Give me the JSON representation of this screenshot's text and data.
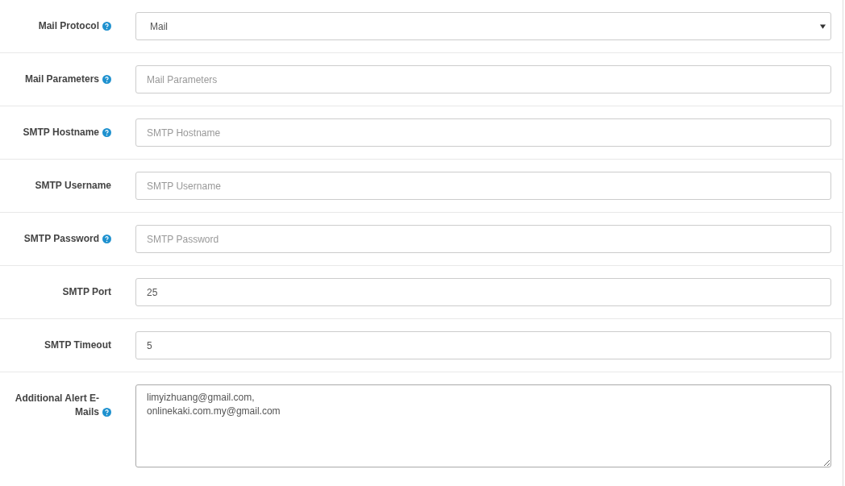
{
  "fields": [
    {
      "kind": "select",
      "label": "Mail Protocol",
      "help": true,
      "value": "Mail"
    },
    {
      "kind": "text",
      "label": "Mail Parameters",
      "help": true,
      "placeholder": "Mail Parameters"
    },
    {
      "kind": "text",
      "label": "SMTP Hostname",
      "help": true,
      "placeholder": "SMTP Hostname"
    },
    {
      "kind": "text",
      "label": "SMTP Username",
      "help": false,
      "placeholder": "SMTP Username"
    },
    {
      "kind": "text",
      "label": "SMTP Password",
      "help": true,
      "placeholder": "SMTP Password"
    },
    {
      "kind": "text",
      "label": "SMTP Port",
      "help": false,
      "value": "25"
    },
    {
      "kind": "text",
      "label": "SMTP Timeout",
      "help": false,
      "value": "5"
    },
    {
      "kind": "textarea",
      "label": "Additional Alert E-Mails",
      "help": true,
      "value": "limyizhuang@gmail.com,\nonlinekaki.com.my@gmail.com"
    }
  ]
}
